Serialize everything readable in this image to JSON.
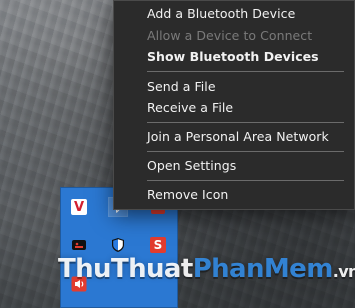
{
  "context_menu": {
    "items": [
      {
        "label": "Add a Bluetooth Device",
        "enabled": true,
        "bold": false
      },
      {
        "label": "Allow a Device to Connect",
        "enabled": false,
        "bold": false
      },
      {
        "label": "Show Bluetooth Devices",
        "enabled": true,
        "bold": true
      },
      {
        "label": "Send a File",
        "enabled": true,
        "bold": false
      },
      {
        "label": "Receive a File",
        "enabled": true,
        "bold": false
      },
      {
        "label": "Join a Personal Area Network",
        "enabled": true,
        "bold": false
      },
      {
        "label": "Open Settings",
        "enabled": true,
        "bold": false
      },
      {
        "label": "Remove Icon",
        "enabled": true,
        "bold": false
      }
    ]
  },
  "tray": {
    "icons": [
      {
        "name": "vietkey-icon",
        "text": "V"
      },
      {
        "name": "bluetooth-icon",
        "text": "ᛒ"
      },
      {
        "name": "app-icon",
        "text": ""
      },
      {
        "name": "gpu-icon",
        "text": ""
      },
      {
        "name": "security-shield-icon",
        "text": ""
      },
      {
        "name": "snagit-icon",
        "text": "S"
      },
      {
        "name": "speaker-icon",
        "text": ""
      }
    ]
  },
  "watermark": {
    "part1": "ThuThuat",
    "part2": "PhanMem",
    "part3": ".vn"
  },
  "colors": {
    "menu_bg": "#2b2b2b",
    "menu_text": "#f2f2f2",
    "menu_disabled": "#7a7a7a",
    "tray_bg": "#2b78d2",
    "watermark_blue": "#3488dc"
  }
}
